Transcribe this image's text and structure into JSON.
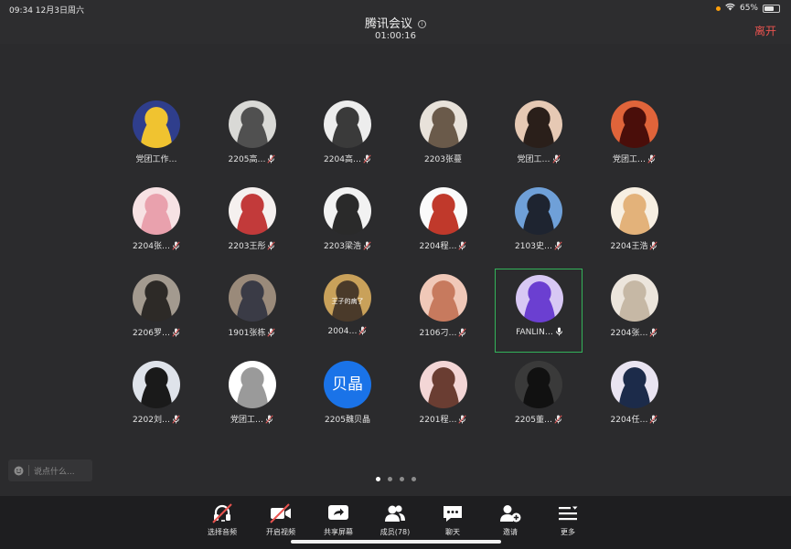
{
  "status_bar": {
    "time_date": "09:34   12月3日周六",
    "battery": "65%",
    "battery_level": 0.65
  },
  "header": {
    "title": "腾讯会议",
    "timer": "01:00:16",
    "leave_label": "离开"
  },
  "participants": [
    {
      "name": "党团工作…",
      "mic": "none",
      "avatar_color": "#2f3e8c",
      "avatar_color2": "#f0c330"
    },
    {
      "name": "2205高…",
      "mic": "muted",
      "avatar_color": "#d9d9d6",
      "avatar_color2": "#505050"
    },
    {
      "name": "2204高…",
      "mic": "muted",
      "avatar_color": "#ededed",
      "avatar_color2": "#3a3a3a"
    },
    {
      "name": "2203张蔓",
      "mic": "none",
      "avatar_color": "#e8e2da",
      "avatar_color2": "#6a5a4a"
    },
    {
      "name": "党团工…",
      "mic": "muted",
      "avatar_color": "#e6c9b4",
      "avatar_color2": "#2a1f1a"
    },
    {
      "name": "党团工…",
      "mic": "muted",
      "avatar_color": "#e0643a",
      "avatar_color2": "#4a0e0a"
    },
    {
      "name": "2204张…",
      "mic": "muted",
      "avatar_color": "#f7e2e4",
      "avatar_color2": "#e9a1ad"
    },
    {
      "name": "2203王彤",
      "mic": "muted",
      "avatar_color": "#f5f0ef",
      "avatar_color2": "#c23a3a"
    },
    {
      "name": "2203梁浩",
      "mic": "muted",
      "avatar_color": "#f2f2f2",
      "avatar_color2": "#2a2a2a"
    },
    {
      "name": "2204程…",
      "mic": "muted",
      "avatar_color": "#fafafa",
      "avatar_color2": "#c0392b"
    },
    {
      "name": "2103史…",
      "mic": "muted",
      "avatar_color": "#6fa0d8",
      "avatar_color2": "#1e2430"
    },
    {
      "name": "2204王浩",
      "mic": "muted",
      "avatar_color": "#f7efe2",
      "avatar_color2": "#e3b27a"
    },
    {
      "name": "2206罗…",
      "mic": "muted",
      "avatar_color": "#a39a8f",
      "avatar_color2": "#2d2a27"
    },
    {
      "name": "1901张栋",
      "mic": "muted",
      "avatar_color": "#9a8a7a",
      "avatar_color2": "#3a3b46"
    },
    {
      "name": "2004…",
      "mic": "muted",
      "avatar_color": "#c9a15a",
      "avatar_color2": "#4a3a2a",
      "avatar_caption": "王子的病了"
    },
    {
      "name": "2106刁…",
      "mic": "muted",
      "avatar_color": "#f0c8b8",
      "avatar_color2": "#c77a5e"
    },
    {
      "name": "FANLIN…",
      "mic": "on",
      "avatar_color": "#d8c8f4",
      "avatar_color2": "#6b3fd1",
      "active": true
    },
    {
      "name": "2204张…",
      "mic": "muted",
      "avatar_color": "#ece5dc",
      "avatar_color2": "#c6b8a5"
    },
    {
      "name": "2202刘…",
      "mic": "muted",
      "avatar_color": "#dfe3ea",
      "avatar_color2": "#1a1a1a"
    },
    {
      "name": "党团工…",
      "mic": "muted",
      "avatar_color": "#ffffff",
      "avatar_color2": "#9a9a9a"
    },
    {
      "name": "2205魏贝晶",
      "mic": "none",
      "avatar_color": "#1a73e8",
      "avatar_color2": "#1a73e8",
      "avatar_text": "贝晶"
    },
    {
      "name": "2201程…",
      "mic": "muted",
      "avatar_color": "#f3d6d6",
      "avatar_color2": "#6a3d32"
    },
    {
      "name": "2205董…",
      "mic": "muted",
      "avatar_color": "#3a3a3a",
      "avatar_color2": "#111111"
    },
    {
      "name": "2204任…",
      "mic": "muted",
      "avatar_color": "#e9e4f1",
      "avatar_color2": "#1c2b4a"
    }
  ],
  "chat": {
    "placeholder": "说点什么..."
  },
  "pager": {
    "count": 4,
    "current": 0
  },
  "toolbar": [
    {
      "label": "选择音频",
      "icon": "headset-off-icon"
    },
    {
      "label": "开启视频",
      "icon": "video-off-icon"
    },
    {
      "label": "共享屏幕",
      "icon": "share-screen-icon"
    },
    {
      "label": "成员(78)",
      "icon": "members-icon"
    },
    {
      "label": "聊天",
      "icon": "chat-icon"
    },
    {
      "label": "邀请",
      "icon": "invite-icon"
    },
    {
      "label": "更多",
      "icon": "more-icon"
    }
  ],
  "colors": {
    "background": "#2b2b2d",
    "toolbar": "#1e1e20",
    "accent_red": "#e9534f",
    "active_border": "#33b35a",
    "mic_muted": "#e45a5a"
  }
}
